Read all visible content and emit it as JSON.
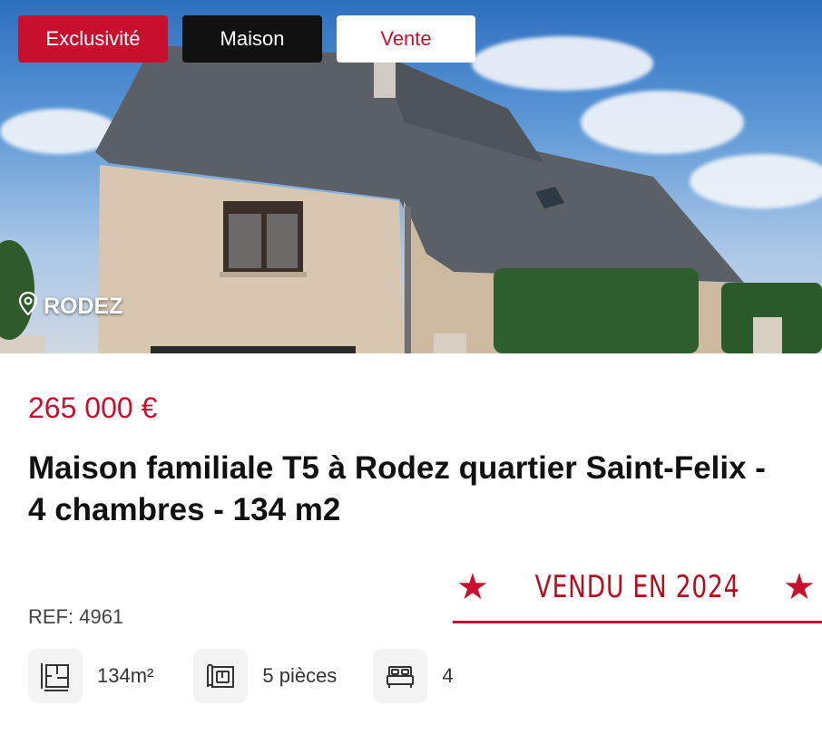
{
  "badges": {
    "exclusive": "Exclusivité",
    "property_type": "Maison",
    "transaction": "Vente"
  },
  "location": "RODEZ",
  "price": "265 000 €",
  "title": "Maison familiale T5 à Rodez quartier Saint-Felix - 4 chambres - 134 m2",
  "sold_banner": "VENDU EN 2024",
  "reference": "REF: 4961",
  "features": {
    "surface": "134m²",
    "rooms": "5 pièces",
    "bedrooms": "4"
  },
  "colors": {
    "accent": "#c8102e",
    "dark_badge": "#111111"
  },
  "icons": {
    "location": "map-pin-icon",
    "surface": "floor-plan-icon",
    "rooms": "blueprint-icon",
    "bedrooms": "bed-icon",
    "sold": "star-icon"
  }
}
